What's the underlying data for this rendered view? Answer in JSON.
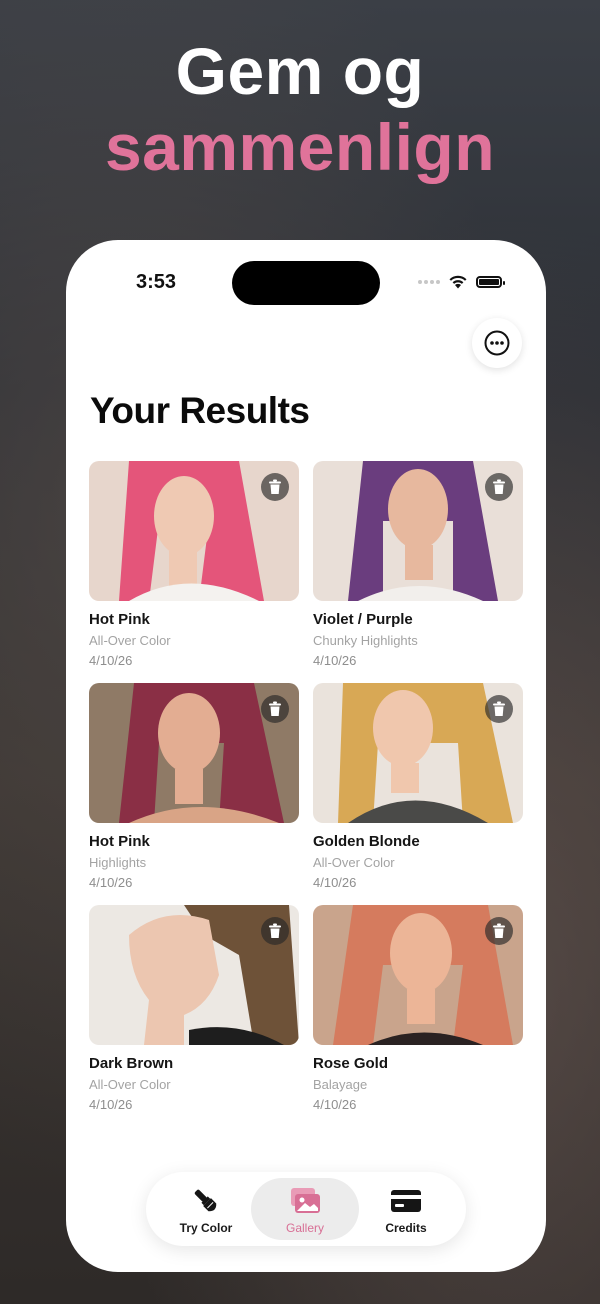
{
  "headline": {
    "line1": "Gem og",
    "line2": "sammenlign"
  },
  "colors": {
    "accent": "#e0739a",
    "tab_active": "#d86f95"
  },
  "status_bar": {
    "time": "3:53",
    "icons": [
      "cellular-dots-icon",
      "wifi-icon",
      "battery-icon"
    ]
  },
  "top_actions": {
    "more_icon": "ellipsis-circle-icon"
  },
  "page": {
    "title": "Your Results"
  },
  "results": [
    {
      "title": "Hot Pink",
      "style": "All-Over Color",
      "date": "4/10/26",
      "hair_color": "#e4557a"
    },
    {
      "title": "Violet / Purple",
      "style": "Chunky Highlights",
      "date": "4/10/26",
      "hair_color": "#6a3d7e"
    },
    {
      "title": "Hot Pink",
      "style": "Highlights",
      "date": "4/10/26",
      "hair_color": "#8a2f45"
    },
    {
      "title": "Golden Blonde",
      "style": "All-Over Color",
      "date": "4/10/26",
      "hair_color": "#d8a855"
    },
    {
      "title": "Dark Brown",
      "style": "All-Over Color",
      "date": "4/10/26",
      "hair_color": "#6e5238"
    },
    {
      "title": "Rose Gold",
      "style": "Balayage",
      "date": "4/10/26",
      "hair_color": "#d57b5e"
    }
  ],
  "tabbar": {
    "tabs": [
      {
        "label": "Try Color",
        "icon": "paintbrush-icon",
        "active": false
      },
      {
        "label": "Gallery",
        "icon": "photo-stack-icon",
        "active": true
      },
      {
        "label": "Credits",
        "icon": "credit-card-icon",
        "active": false
      }
    ]
  }
}
